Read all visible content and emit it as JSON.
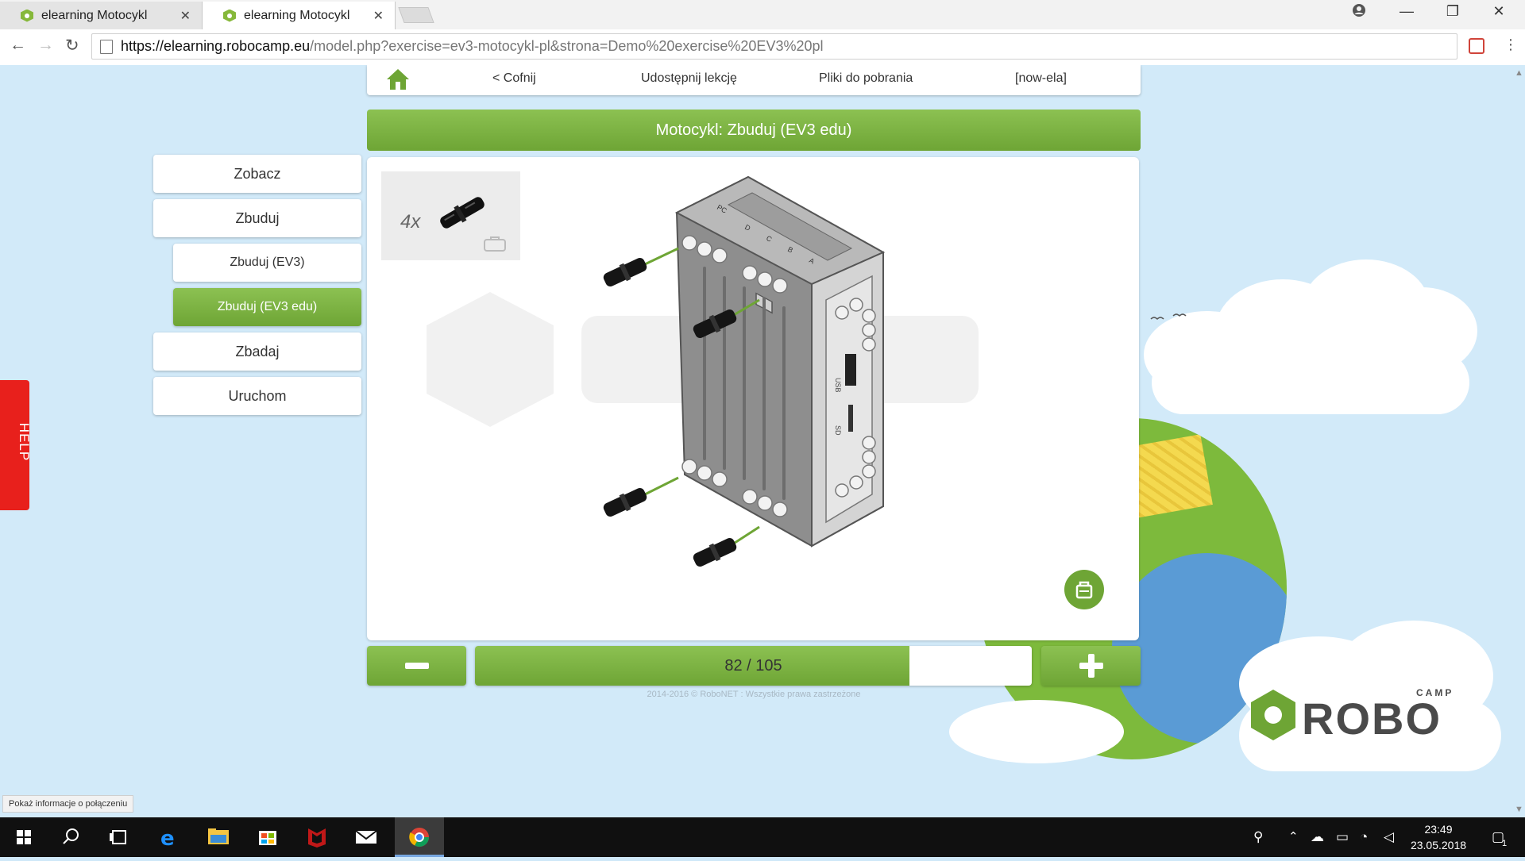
{
  "browser": {
    "tabs": [
      {
        "title": "elearning Motocykl",
        "active": false
      },
      {
        "title": "elearning Motocykl",
        "active": true
      }
    ],
    "url_host": "https://elearning.robocamp.eu",
    "url_path": "/model.php?exercise=ev3-motocykl-pl&strona=Demo%20exercise%20EV3%20pl",
    "status_text": "Pokaż informacje o połączeniu"
  },
  "nav": {
    "back": "< Cofnij",
    "share": "Udostępnij lekcję",
    "downloads": "Pliki do pobrania",
    "user": "[now-ela]"
  },
  "title": "Motocykl: Zbuduj (EV3 edu)",
  "sidebar": {
    "items": [
      {
        "label": "Zobacz",
        "level": "main",
        "active": false
      },
      {
        "label": "Zbuduj",
        "level": "main",
        "active": false
      },
      {
        "label": "Zbuduj (EV3)",
        "level": "sub",
        "active": false
      },
      {
        "label": "Zbuduj (EV3 edu)",
        "level": "sub",
        "active": true
      },
      {
        "label": "Zbadaj",
        "level": "main",
        "active": false
      },
      {
        "label": "Uruchom",
        "level": "main",
        "active": false
      }
    ]
  },
  "help_label": "HELP",
  "parts": {
    "quantity": "4x",
    "part_icon": "black-axle-pin-icon"
  },
  "model": {
    "ports_top": [
      "PC",
      "D",
      "C",
      "B",
      "A"
    ],
    "side_labels": [
      "USB",
      "SD"
    ]
  },
  "pagination": {
    "text": "82 / 105",
    "current": 82,
    "total": 105
  },
  "copyright": "2014-2016 © RoboNET : Wszystkie prawa zastrzeżone",
  "logo": {
    "brand": "ROBO",
    "sub": "CAMP"
  },
  "taskbar": {
    "time": "23:49",
    "date": "23.05.2018",
    "notification_count": "1"
  },
  "colors": {
    "green": "#7db441",
    "help_red": "#e8201c",
    "sky": "#d2eaf9"
  }
}
